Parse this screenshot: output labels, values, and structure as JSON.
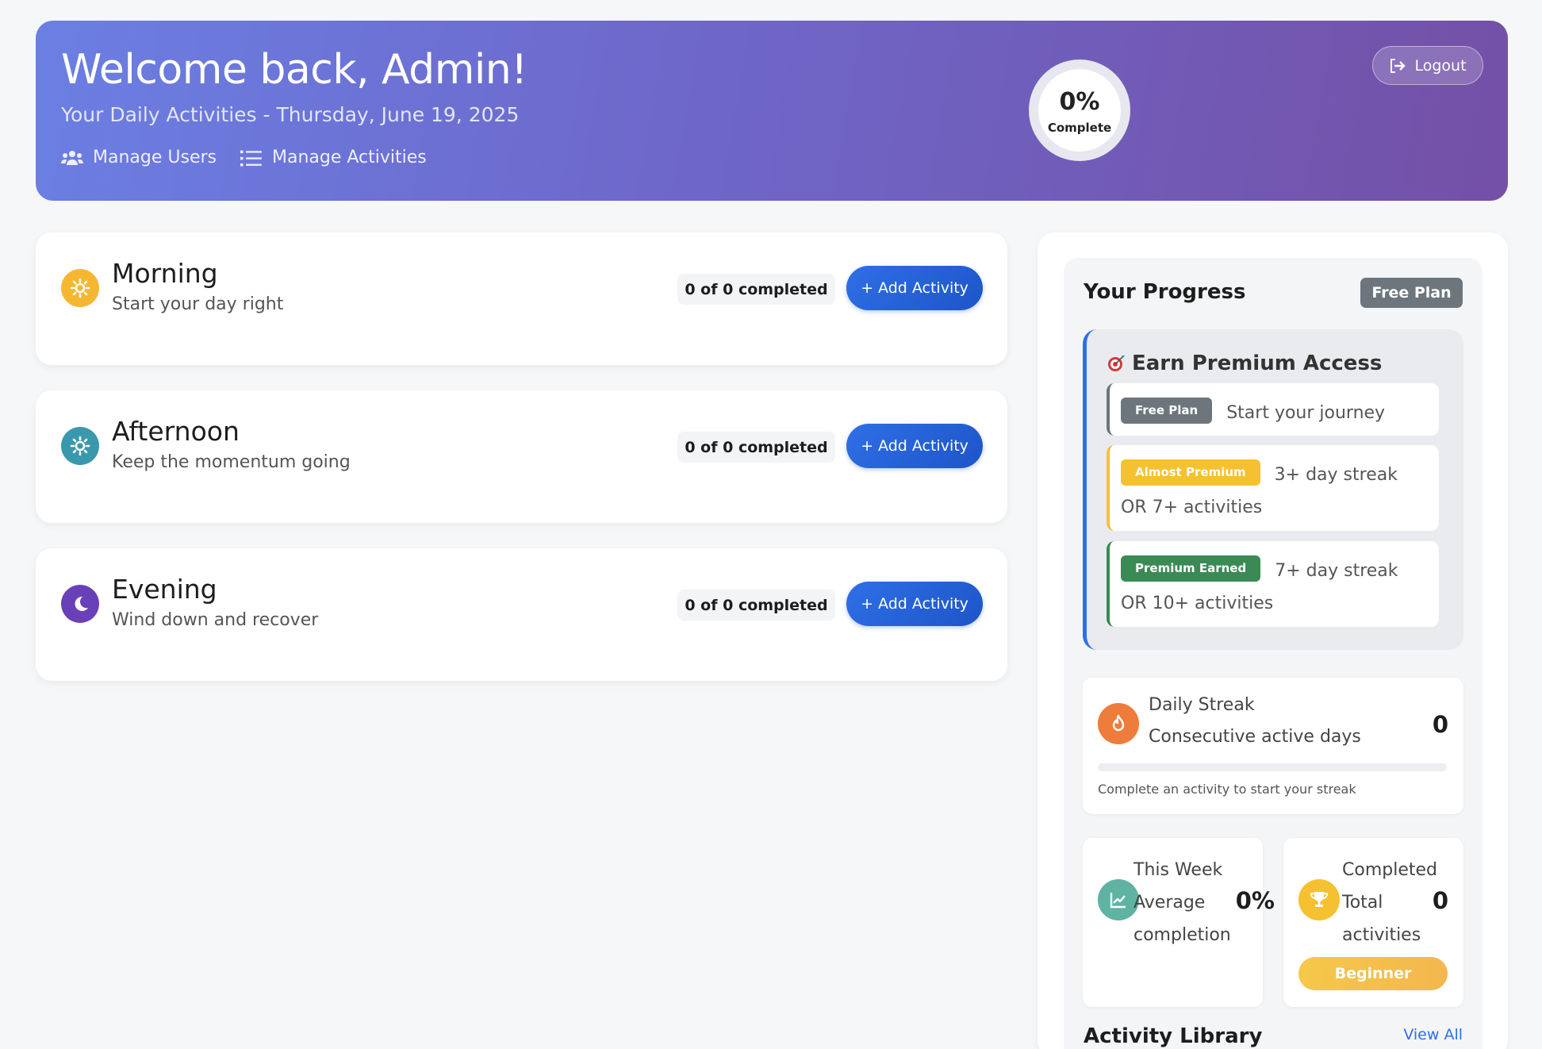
{
  "header": {
    "welcome": "Welcome back, Admin!",
    "subtitle": "Your Daily Activities - Thursday, June 19, 2025",
    "links": [
      {
        "label": "Manage Users",
        "icon": "users-icon"
      },
      {
        "label": "Manage Activities",
        "icon": "list-icon"
      }
    ],
    "completion": {
      "value": "0%",
      "label": "Complete"
    },
    "logout_label": "Logout"
  },
  "periods": [
    {
      "title": "Morning",
      "subtitle": "Start your day right",
      "count": "0 of 0 completed",
      "add_label": "+ Add Activity",
      "icon": "sun-icon",
      "color": "#f5b731"
    },
    {
      "title": "Afternoon",
      "subtitle": "Keep the momentum going",
      "count": "0 of 0 completed",
      "add_label": "+ Add Activity",
      "icon": "sun-icon",
      "color": "#3a98ac"
    },
    {
      "title": "Evening",
      "subtitle": "Wind down and recover",
      "count": "0 of 0 completed",
      "add_label": "+ Add Activity",
      "icon": "moon-icon",
      "color": "#6a40b8"
    }
  ],
  "progress": {
    "title": "Your Progress",
    "plan_badge": "Free Plan",
    "premium": {
      "title": "Earn Premium Access",
      "tiers": [
        {
          "badge": "Free Plan",
          "text": "Start your journey",
          "color": "#6d757d"
        },
        {
          "badge": "Almost Premium",
          "text": "3+ day streak OR 7+ activities",
          "color": "#f5c130"
        },
        {
          "badge": "Premium Earned",
          "text": "7+ day streak OR 10+ activities",
          "color": "#3a8a55"
        }
      ]
    },
    "streak": {
      "title": "Daily Streak",
      "subtitle": "Consecutive active days",
      "value": "0",
      "progress": 0,
      "hint": "Complete an activity to start your streak"
    },
    "week": {
      "title": "This Week",
      "subtitle": "Average completion",
      "value": "0%"
    },
    "completed": {
      "title": "Completed",
      "subtitle": "Total activities",
      "value": "0",
      "level": "Beginner"
    }
  },
  "library": {
    "title": "Activity Library",
    "view_all": "View All"
  }
}
